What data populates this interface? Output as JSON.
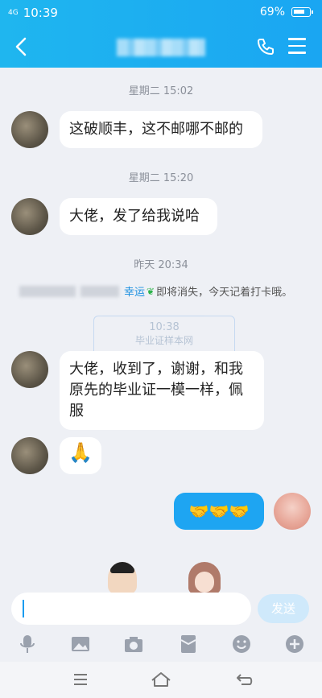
{
  "status": {
    "network": "4G",
    "time": "10:39",
    "battery": "69%"
  },
  "chat": {
    "messages": [
      {
        "time": "星期二 15:02",
        "text": "这破顺丰，这不邮哪不邮的"
      },
      {
        "time": "星期二 15:20",
        "text": "大佬，发了给我说哈"
      },
      {
        "time": "昨天 20:34"
      }
    ],
    "system_notice": {
      "highlight": "幸运",
      "suffix": "即将消失，今天记着打卡哦。"
    },
    "watermark": {
      "time": "10:38",
      "brand": "毕业证样本网"
    },
    "message3_text": "大佬，收到了，谢谢，和我原先的毕业证一模一样，佩服",
    "message4_emoji": "🙏",
    "my_message_emoji": "🤝🤝🤝"
  },
  "input": {
    "send_label": "发送"
  },
  "colors": {
    "header": "#1aa6f2",
    "my_bubble": "#1ea5f2"
  }
}
